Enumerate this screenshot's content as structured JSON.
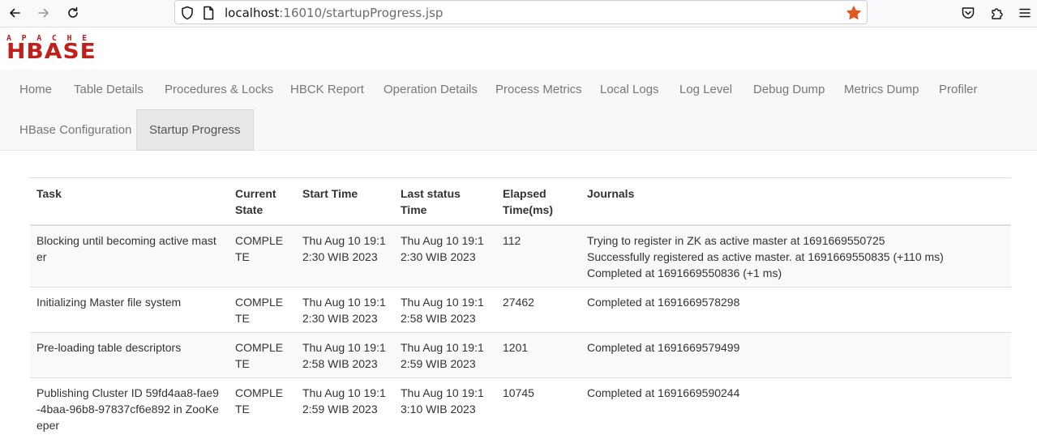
{
  "browser": {
    "url_host": "localhost",
    "url_rest": ":16010/startupProgress.jsp"
  },
  "logo": {
    "top": "APACHE",
    "main": "HBASE"
  },
  "nav": [
    "Home",
    "Table Details",
    "Procedures & Locks",
    "HBCK Report",
    "Operation Details",
    "Process Metrics",
    "Local Logs",
    "Log Level",
    "Debug Dump",
    "Metrics Dump",
    "Profiler",
    "HBase Configuration",
    "Startup Progress"
  ],
  "table": {
    "headers": [
      "Task",
      "Current State",
      "Start Time",
      "Last status Time",
      "Elapsed Time(ms)",
      "Journals"
    ],
    "rows": [
      {
        "task": "Blocking until becoming active master",
        "state": "COMPLETE",
        "start": "Thu Aug 10 19:12:30 WIB 2023",
        "last": "Thu Aug 10 19:12:30 WIB 2023",
        "elapsed": "112",
        "journals": [
          "Trying to register in ZK as active master at 1691669550725",
          "Successfully registered as active master. at 1691669550835 (+110 ms)",
          "Completed at 1691669550836 (+1 ms)"
        ]
      },
      {
        "task": "Initializing Master file system",
        "state": "COMPLETE",
        "start": "Thu Aug 10 19:12:30 WIB 2023",
        "last": "Thu Aug 10 19:12:58 WIB 2023",
        "elapsed": "27462",
        "journals": [
          "Completed at 1691669578298"
        ]
      },
      {
        "task": "Pre-loading table descriptors",
        "state": "COMPLETE",
        "start": "Thu Aug 10 19:12:58 WIB 2023",
        "last": "Thu Aug 10 19:12:59 WIB 2023",
        "elapsed": "1201",
        "journals": [
          "Completed at 1691669579499"
        ]
      },
      {
        "task": "Publishing Cluster ID 59fd4aa8-fae9-4baa-96b8-97837cf6e892 in ZooKeeper",
        "state": "COMPLETE",
        "start": "Thu Aug 10 19:12:59 WIB 2023",
        "last": "Thu Aug 10 19:13:10 WIB 2023",
        "elapsed": "10745",
        "journals": [
          "Completed at 1691669590244"
        ]
      }
    ]
  }
}
